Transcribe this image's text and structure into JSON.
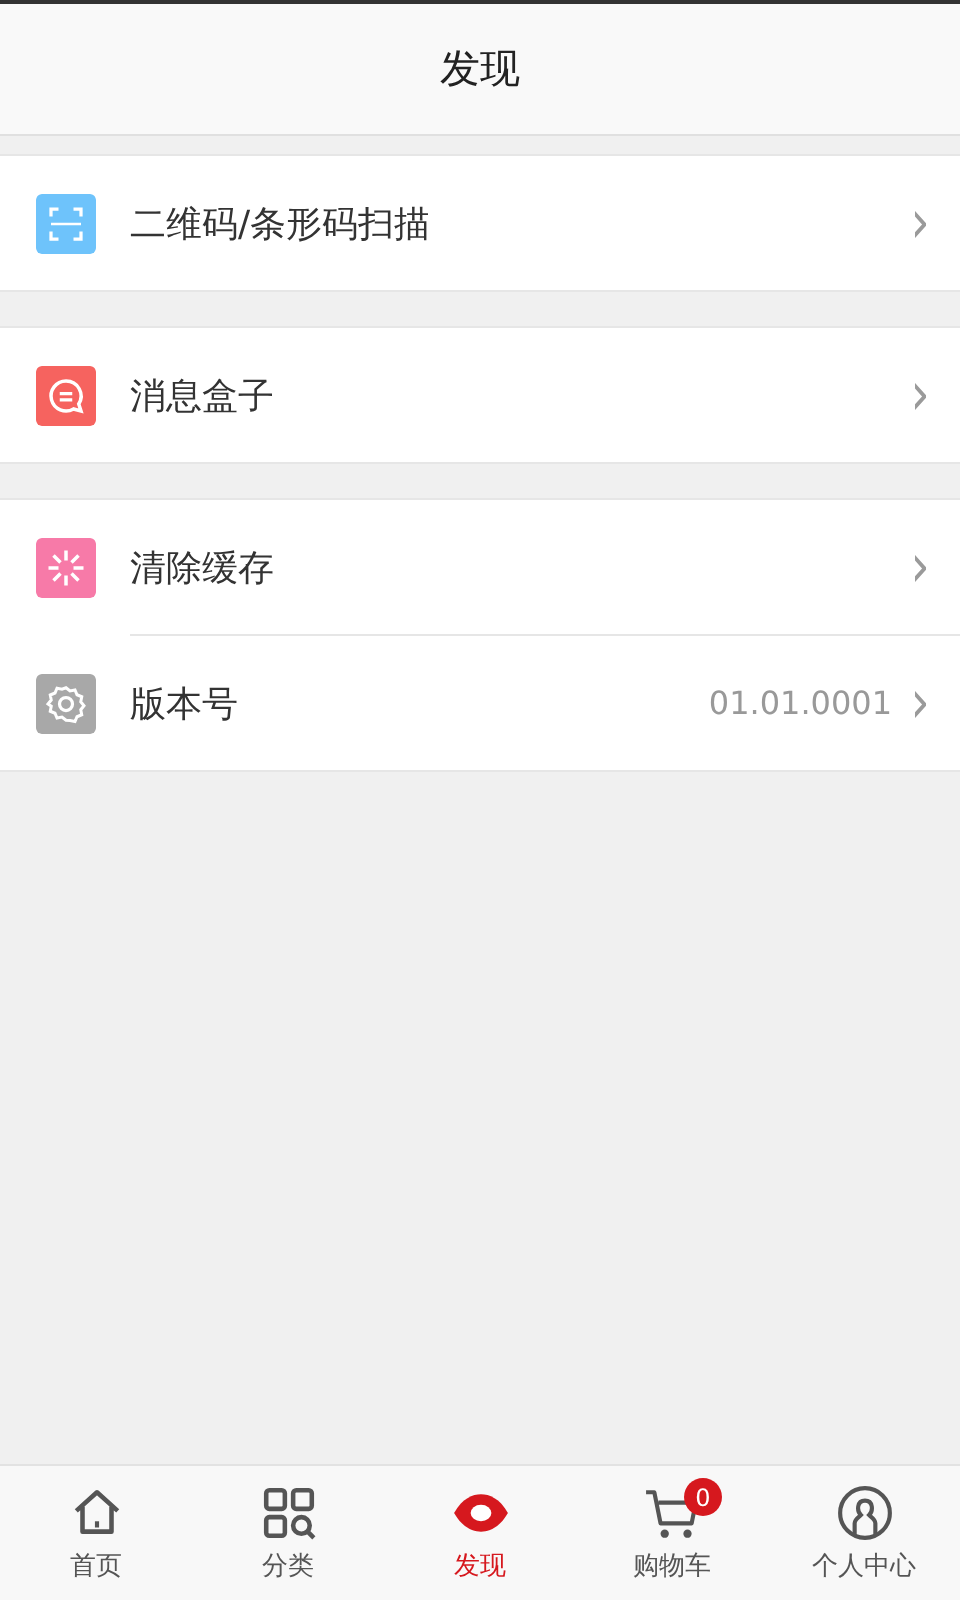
{
  "header": {
    "title": "发现"
  },
  "sections": [
    {
      "items": [
        {
          "kind": "scan",
          "color": "#6ec3fb",
          "label": "二维码/条形码扫描",
          "arrow": "›"
        }
      ]
    },
    {
      "items": [
        {
          "kind": "message",
          "color": "#f6635f",
          "label": "消息盒子",
          "arrow": "›"
        }
      ]
    },
    {
      "items": [
        {
          "kind": "clear",
          "color": "#f77aa8",
          "label": "清除缓存",
          "arrow": "›"
        },
        {
          "kind": "settings",
          "color": "#a8a8a8",
          "label": "版本号",
          "value": "01.01.0001",
          "arrow": "›"
        }
      ]
    }
  ],
  "tabbar": [
    {
      "kind": "home",
      "label": "首页",
      "selected": false
    },
    {
      "kind": "category",
      "label": "分类",
      "selected": false
    },
    {
      "kind": "discover",
      "label": "发现",
      "selected": true
    },
    {
      "kind": "cart",
      "label": "购物车",
      "selected": false,
      "badge": "0"
    },
    {
      "kind": "profile",
      "label": "个人中心",
      "selected": false
    }
  ]
}
